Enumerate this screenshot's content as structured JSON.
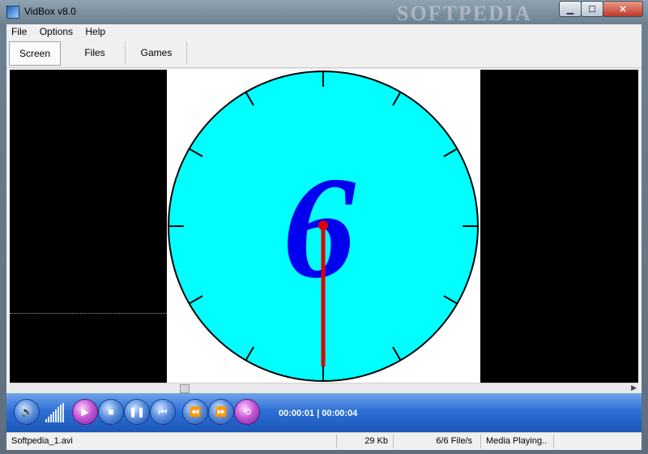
{
  "window": {
    "title": "VidBox v8.0",
    "watermark": "SOFTPEDIA",
    "buttons": {
      "minimize": "▁",
      "maximize": "☐",
      "close": "✕"
    }
  },
  "menu": {
    "items": [
      "File",
      "Options",
      "Help"
    ]
  },
  "tabs": [
    {
      "label": "Screen",
      "active": true
    },
    {
      "label": "Files",
      "active": false
    },
    {
      "label": "Games",
      "active": false
    }
  ],
  "player": {
    "time_display": "00:00:01 | 00:00:04",
    "icons": {
      "volume": "speaker-icon",
      "volume_level": "volume-bars-icon",
      "play": "play-icon",
      "stop": "stop-icon",
      "pause": "pause-icon",
      "prev": "skip-back-icon",
      "rewind": "rewind-icon",
      "forward": "fast-forward-icon",
      "repeat": "repeat-icon"
    },
    "glyphs": {
      "volume": "🔊",
      "play": "▶",
      "stop": "■",
      "pause": "❚❚",
      "prev": "⏮",
      "rewind": "⏪",
      "forward": "⏩",
      "repeat": "⟲"
    }
  },
  "video_frame": {
    "digit": "6",
    "colors": {
      "face": "#00ffff",
      "digit": "#0000ee",
      "hand": "#e00000"
    }
  },
  "status": {
    "filename": "Softpedia_1.avi",
    "size": "29 Kb",
    "rate": "6/6 File/s",
    "state": "Media Playing.."
  }
}
